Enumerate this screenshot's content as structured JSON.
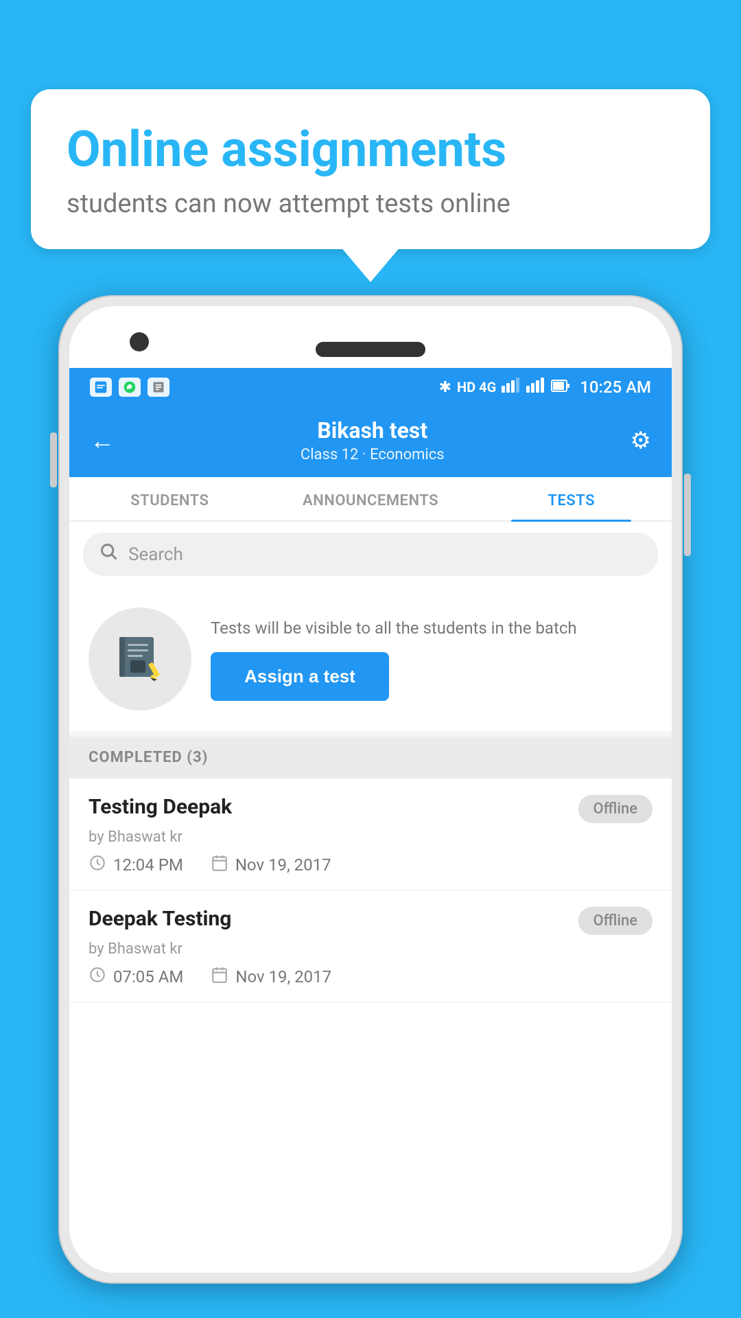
{
  "background_color": "#29B6F6",
  "speech_bubble": {
    "title": "Online assignments",
    "subtitle": "students can now attempt tests online"
  },
  "status_bar": {
    "time": "10:25 AM",
    "signal": "HD 4G",
    "icons": [
      "📋",
      "💬",
      "🖼"
    ]
  },
  "app_header": {
    "back_label": "←",
    "title": "Bikash test",
    "subtitle": "Class 12 · Economics",
    "gear_label": "⚙"
  },
  "tabs": [
    {
      "label": "STUDENTS",
      "active": false
    },
    {
      "label": "ANNOUNCEMENTS",
      "active": false
    },
    {
      "label": "TESTS",
      "active": true
    }
  ],
  "search": {
    "placeholder": "Search"
  },
  "assign_section": {
    "description": "Tests will be visible to all the students in the batch",
    "button_label": "Assign a test"
  },
  "completed_section": {
    "label": "COMPLETED (3)",
    "items": [
      {
        "name": "Testing Deepak",
        "by": "by Bhaswat kr",
        "time": "12:04 PM",
        "date": "Nov 19, 2017",
        "badge": "Offline"
      },
      {
        "name": "Deepak Testing",
        "by": "by Bhaswat kr",
        "time": "07:05 AM",
        "date": "Nov 19, 2017",
        "badge": "Offline"
      }
    ]
  }
}
